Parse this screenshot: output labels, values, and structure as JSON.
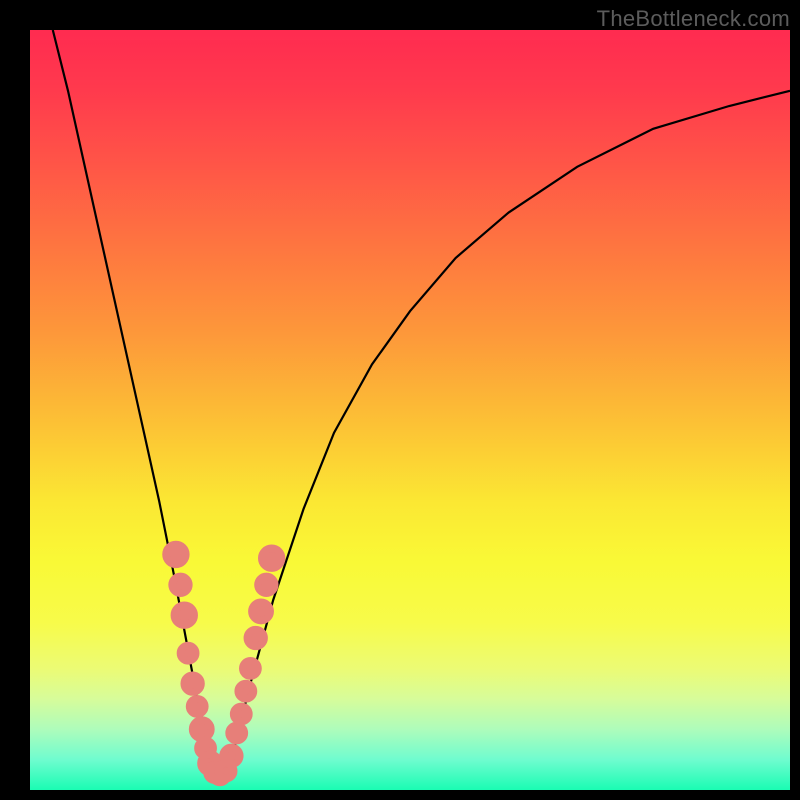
{
  "watermark": "TheBottleneck.com",
  "gradient_css": "linear-gradient(to bottom, #ff2b50 0%, #ff3a4d 8%, #ff5647 18%, #fe7a3f 30%, #fd983a 40%, #fcc235 52%, #fbe733 62%, #f9f936 70%, #f7fb4a 78%, #ecfb74 84%, #d7fc9a 88%, #aefcbb 92%, #6ffccf 96%, #1afcb3 100%)",
  "colors": {
    "curve": "#000000",
    "marker": "#e77f79",
    "frame": "#000000"
  },
  "chart_data": {
    "type": "line",
    "title": "",
    "xlabel": "",
    "ylabel": "",
    "xlim": [
      0,
      100
    ],
    "ylim": [
      0,
      100
    ],
    "grid": false,
    "legend": false,
    "series": [
      {
        "name": "bottleneck-curve",
        "x": [
          3,
          5,
          7,
          9,
          11,
          13,
          15,
          17,
          19,
          20.5,
          22,
          23.5,
          24.5,
          25.5,
          27,
          29,
          32,
          36,
          40,
          45,
          50,
          56,
          63,
          72,
          82,
          92,
          100
        ],
        "y": [
          100,
          92,
          83,
          74,
          65,
          56,
          47,
          38,
          28,
          20,
          12,
          6,
          2,
          2,
          6,
          14,
          25,
          37,
          47,
          56,
          63,
          70,
          76,
          82,
          87,
          90,
          92
        ]
      }
    ],
    "markers": [
      {
        "x": 19.2,
        "y": 31,
        "r": 1.3
      },
      {
        "x": 19.8,
        "y": 27,
        "r": 1.1
      },
      {
        "x": 20.3,
        "y": 23,
        "r": 1.3
      },
      {
        "x": 20.8,
        "y": 18,
        "r": 1.0
      },
      {
        "x": 21.4,
        "y": 14,
        "r": 1.1
      },
      {
        "x": 22.0,
        "y": 11,
        "r": 1.0
      },
      {
        "x": 22.6,
        "y": 8,
        "r": 1.2
      },
      {
        "x": 23.1,
        "y": 5.5,
        "r": 1.0
      },
      {
        "x": 23.7,
        "y": 3.5,
        "r": 1.2
      },
      {
        "x": 24.3,
        "y": 2.3,
        "r": 1.0
      },
      {
        "x": 25.0,
        "y": 2.0,
        "r": 1.0
      },
      {
        "x": 25.8,
        "y": 2.5,
        "r": 1.0
      },
      {
        "x": 26.5,
        "y": 4.5,
        "r": 1.1
      },
      {
        "x": 27.2,
        "y": 7.5,
        "r": 1.0
      },
      {
        "x": 27.8,
        "y": 10,
        "r": 1.0
      },
      {
        "x": 28.4,
        "y": 13,
        "r": 1.0
      },
      {
        "x": 29.0,
        "y": 16,
        "r": 1.0
      },
      {
        "x": 29.7,
        "y": 20,
        "r": 1.1
      },
      {
        "x": 30.4,
        "y": 23.5,
        "r": 1.2
      },
      {
        "x": 31.1,
        "y": 27,
        "r": 1.1
      },
      {
        "x": 31.8,
        "y": 30.5,
        "r": 1.3
      }
    ]
  }
}
